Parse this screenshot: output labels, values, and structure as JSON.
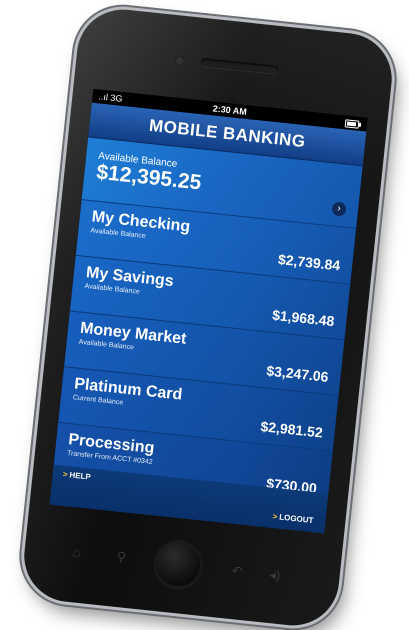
{
  "status_bar": {
    "signal": "..ıl 3G",
    "time": "2:30 AM",
    "battery_icon": "battery-icon"
  },
  "app": {
    "title": "MOBILE BANKING"
  },
  "balance": {
    "label": "Available Balance",
    "value": "$12,395.25",
    "go_icon": "arrow-right-circle-icon"
  },
  "accounts": [
    {
      "name": "My Checking",
      "sub": "Available Balance",
      "amount": "$2,739.84"
    },
    {
      "name": "My Savings",
      "sub": "Available Balance",
      "amount": "$1,968.48"
    },
    {
      "name": "Money Market",
      "sub": "Available Balance",
      "amount": "$3,247.06"
    },
    {
      "name": "Platinum Card",
      "sub": "Current Balance",
      "amount": "$2,981.52"
    },
    {
      "name": "Processing",
      "sub": "Transfer From ACCT #0342",
      "amount": "$730.00"
    }
  ],
  "footer": {
    "help": "HELP",
    "logout": "LOGOUT",
    "chevron": ">"
  },
  "hardware_icons": {
    "home": "home-icon",
    "search": "search-icon",
    "back": "back-icon",
    "volume": "volume-icon"
  },
  "colors": {
    "screen_blue": "#1a66c2",
    "header_blue": "#2a64b5",
    "chevron_yellow": "#ffcc33"
  }
}
